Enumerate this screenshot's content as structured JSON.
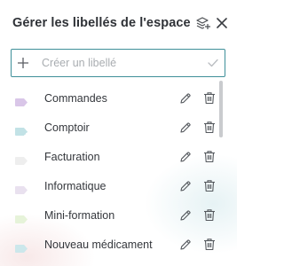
{
  "header": {
    "title": "Gérer les libellés de l'espace",
    "stack_icon": "layers-plus-icon",
    "close_icon": "close-icon"
  },
  "create": {
    "placeholder": "Créer un libellé",
    "plus_icon": "plus-icon",
    "check_icon": "check-icon",
    "border_color": "#3e8f99"
  },
  "labels": [
    {
      "name": "Commandes",
      "color": "#d9c6e8",
      "pattern": "solid"
    },
    {
      "name": "Comptoir",
      "color": "#b8dfe3",
      "pattern": "dots"
    },
    {
      "name": "Facturation",
      "color": "#eeeeee",
      "pattern": "solid"
    },
    {
      "name": "Informatique",
      "color": "#e9e1ef",
      "pattern": "solid"
    },
    {
      "name": "Mini-formation",
      "color": "#e6f3d9",
      "pattern": "solid"
    },
    {
      "name": "Nouveau médicament",
      "color": "#cce7eb",
      "pattern": "solid"
    }
  ],
  "row_actions": {
    "edit_icon": "pencil-icon",
    "delete_icon": "trash-icon"
  }
}
